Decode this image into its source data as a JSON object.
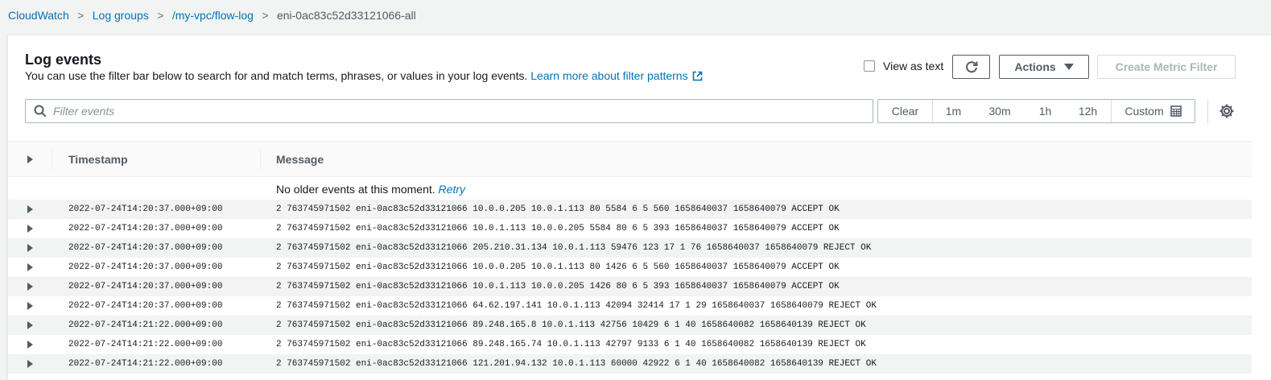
{
  "breadcrumb": {
    "items": [
      "CloudWatch",
      "Log groups",
      "/my-vpc/flow-log"
    ],
    "separator": ">",
    "current": "eni-0ac83c52d33121066-all"
  },
  "panel": {
    "title": "Log events",
    "description": "You can use the filter bar below to search for and match terms, phrases, or values in your log events.",
    "learn_more": "Learn more about filter patterns",
    "view_as_text": "View as text",
    "actions_label": "Actions",
    "create_metric_filter": "Create Metric Filter"
  },
  "filter": {
    "placeholder": "Filter events",
    "ranges": [
      "Clear",
      "1m",
      "30m",
      "1h",
      "12h",
      "Custom"
    ]
  },
  "table": {
    "columns": [
      "Timestamp",
      "Message"
    ],
    "notice": "No older events at this moment.",
    "retry": "Retry",
    "rows": [
      {
        "timestamp": "2022-07-24T14:20:37.000+09:00",
        "message": "2 763745971502 eni-0ac83c52d33121066 10.0.0.205 10.0.1.113 80 5584 6 5 560 1658640037 1658640079 ACCEPT OK"
      },
      {
        "timestamp": "2022-07-24T14:20:37.000+09:00",
        "message": "2 763745971502 eni-0ac83c52d33121066 10.0.1.113 10.0.0.205 5584 80 6 5 393 1658640037 1658640079 ACCEPT OK"
      },
      {
        "timestamp": "2022-07-24T14:20:37.000+09:00",
        "message": "2 763745971502 eni-0ac83c52d33121066 205.210.31.134 10.0.1.113 59476 123 17 1 76 1658640037 1658640079 REJECT OK"
      },
      {
        "timestamp": "2022-07-24T14:20:37.000+09:00",
        "message": "2 763745971502 eni-0ac83c52d33121066 10.0.0.205 10.0.1.113 80 1426 6 5 560 1658640037 1658640079 ACCEPT OK"
      },
      {
        "timestamp": "2022-07-24T14:20:37.000+09:00",
        "message": "2 763745971502 eni-0ac83c52d33121066 10.0.1.113 10.0.0.205 1426 80 6 5 393 1658640037 1658640079 ACCEPT OK"
      },
      {
        "timestamp": "2022-07-24T14:20:37.000+09:00",
        "message": "2 763745971502 eni-0ac83c52d33121066 64.62.197.141 10.0.1.113 42094 32414 17 1 29 1658640037 1658640079 REJECT OK"
      },
      {
        "timestamp": "2022-07-24T14:21:22.000+09:00",
        "message": "2 763745971502 eni-0ac83c52d33121066 89.248.165.8 10.0.1.113 42756 10429 6 1 40 1658640082 1658640139 REJECT OK"
      },
      {
        "timestamp": "2022-07-24T14:21:22.000+09:00",
        "message": "2 763745971502 eni-0ac83c52d33121066 89.248.165.74 10.0.1.113 42797 9133 6 1 40 1658640082 1658640139 REJECT OK"
      },
      {
        "timestamp": "2022-07-24T14:21:22.000+09:00",
        "message": "2 763745971502 eni-0ac83c52d33121066 121.201.94.132 10.0.1.113 60000 42922 6 1 40 1658640082 1658640139 REJECT OK"
      }
    ]
  },
  "colors": {
    "link": "#0073bb",
    "row_alt": "#f2f3f3",
    "border": "#aab7b8"
  },
  "icons": [
    "external-link-icon",
    "refresh-icon",
    "caret-down-icon",
    "search-icon",
    "calendar-icon",
    "gear-icon",
    "expand-caret-icon"
  ]
}
